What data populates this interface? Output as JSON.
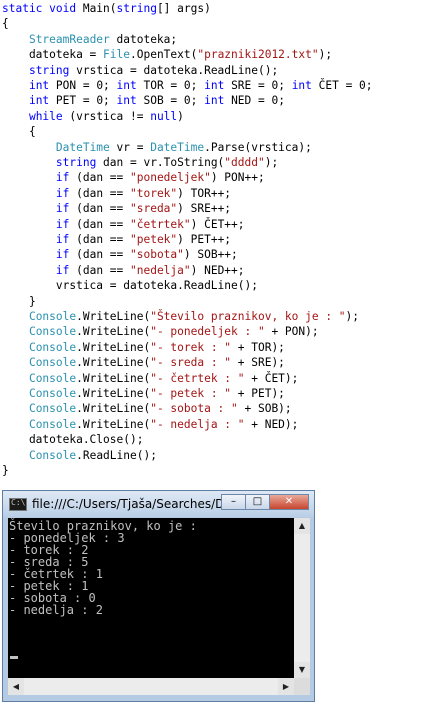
{
  "code": {
    "lines": [
      [
        {
          "t": "static void ",
          "c": "kw"
        },
        {
          "t": "Main(",
          "c": ""
        },
        {
          "t": "string",
          "c": "kw"
        },
        {
          "t": "[] args)",
          "c": ""
        }
      ],
      [
        {
          "t": "{",
          "c": ""
        }
      ],
      [
        {
          "t": "    ",
          "c": ""
        },
        {
          "t": "StreamReader",
          "c": "ty"
        },
        {
          "t": " datoteka;",
          "c": ""
        }
      ],
      [
        {
          "t": "    datoteka = ",
          "c": ""
        },
        {
          "t": "File",
          "c": "ty"
        },
        {
          "t": ".OpenText(",
          "c": ""
        },
        {
          "t": "\"prazniki2012.txt\"",
          "c": "st"
        },
        {
          "t": ");",
          "c": ""
        }
      ],
      [
        {
          "t": "    ",
          "c": ""
        },
        {
          "t": "string",
          "c": "kw"
        },
        {
          "t": " vrstica = datoteka.ReadLine();",
          "c": ""
        }
      ],
      [
        {
          "t": "    ",
          "c": ""
        },
        {
          "t": "int",
          "c": "kw"
        },
        {
          "t": " PON = 0; ",
          "c": ""
        },
        {
          "t": "int",
          "c": "kw"
        },
        {
          "t": " TOR = 0; ",
          "c": ""
        },
        {
          "t": "int",
          "c": "kw"
        },
        {
          "t": " SRE = 0; ",
          "c": ""
        },
        {
          "t": "int",
          "c": "kw"
        },
        {
          "t": " ČET = 0;",
          "c": ""
        }
      ],
      [
        {
          "t": "    ",
          "c": ""
        },
        {
          "t": "int",
          "c": "kw"
        },
        {
          "t": " PET = 0; ",
          "c": ""
        },
        {
          "t": "int",
          "c": "kw"
        },
        {
          "t": " SOB = 0; ",
          "c": ""
        },
        {
          "t": "int",
          "c": "kw"
        },
        {
          "t": " NED = 0;",
          "c": ""
        }
      ],
      [
        {
          "t": "    ",
          "c": ""
        },
        {
          "t": "while",
          "c": "kw"
        },
        {
          "t": " (vrstica != ",
          "c": ""
        },
        {
          "t": "null",
          "c": "kw"
        },
        {
          "t": ")",
          "c": ""
        }
      ],
      [
        {
          "t": "    {",
          "c": ""
        }
      ],
      [
        {
          "t": "        ",
          "c": ""
        },
        {
          "t": "DateTime",
          "c": "ty"
        },
        {
          "t": " vr = ",
          "c": ""
        },
        {
          "t": "DateTime",
          "c": "ty"
        },
        {
          "t": ".Parse(vrstica);",
          "c": ""
        }
      ],
      [
        {
          "t": "        ",
          "c": ""
        },
        {
          "t": "string",
          "c": "kw"
        },
        {
          "t": " dan = vr.ToString(",
          "c": ""
        },
        {
          "t": "\"dddd\"",
          "c": "st"
        },
        {
          "t": ");",
          "c": ""
        }
      ],
      [
        {
          "t": "        ",
          "c": ""
        },
        {
          "t": "if",
          "c": "kw"
        },
        {
          "t": " (dan == ",
          "c": ""
        },
        {
          "t": "\"ponedeljek\"",
          "c": "st"
        },
        {
          "t": ") PON++;",
          "c": ""
        }
      ],
      [
        {
          "t": "        ",
          "c": ""
        },
        {
          "t": "if",
          "c": "kw"
        },
        {
          "t": " (dan == ",
          "c": ""
        },
        {
          "t": "\"torek\"",
          "c": "st"
        },
        {
          "t": ") TOR++;",
          "c": ""
        }
      ],
      [
        {
          "t": "        ",
          "c": ""
        },
        {
          "t": "if",
          "c": "kw"
        },
        {
          "t": " (dan == ",
          "c": ""
        },
        {
          "t": "\"sreda\"",
          "c": "st"
        },
        {
          "t": ") SRE++;",
          "c": ""
        }
      ],
      [
        {
          "t": "        ",
          "c": ""
        },
        {
          "t": "if",
          "c": "kw"
        },
        {
          "t": " (dan == ",
          "c": ""
        },
        {
          "t": "\"četrtek\"",
          "c": "st"
        },
        {
          "t": ") ČET++;",
          "c": ""
        }
      ],
      [
        {
          "t": "        ",
          "c": ""
        },
        {
          "t": "if",
          "c": "kw"
        },
        {
          "t": " (dan == ",
          "c": ""
        },
        {
          "t": "\"petek\"",
          "c": "st"
        },
        {
          "t": ") PET++;",
          "c": ""
        }
      ],
      [
        {
          "t": "        ",
          "c": ""
        },
        {
          "t": "if",
          "c": "kw"
        },
        {
          "t": " (dan == ",
          "c": ""
        },
        {
          "t": "\"sobota\"",
          "c": "st"
        },
        {
          "t": ") SOB++;",
          "c": ""
        }
      ],
      [
        {
          "t": "        ",
          "c": ""
        },
        {
          "t": "if",
          "c": "kw"
        },
        {
          "t": " (dan == ",
          "c": ""
        },
        {
          "t": "\"nedelja\"",
          "c": "st"
        },
        {
          "t": ") NED++;",
          "c": ""
        }
      ],
      [
        {
          "t": "        vrstica = datoteka.ReadLine();",
          "c": ""
        }
      ],
      [
        {
          "t": "    }",
          "c": ""
        }
      ],
      [
        {
          "t": "    ",
          "c": ""
        },
        {
          "t": "Console",
          "c": "ty"
        },
        {
          "t": ".WriteLine(",
          "c": ""
        },
        {
          "t": "\"Število praznikov, ko je : \"",
          "c": "st"
        },
        {
          "t": ");",
          "c": ""
        }
      ],
      [
        {
          "t": "    ",
          "c": ""
        },
        {
          "t": "Console",
          "c": "ty"
        },
        {
          "t": ".WriteLine(",
          "c": ""
        },
        {
          "t": "\"- ponedeljek : \"",
          "c": "st"
        },
        {
          "t": " + PON);",
          "c": ""
        }
      ],
      [
        {
          "t": "    ",
          "c": ""
        },
        {
          "t": "Console",
          "c": "ty"
        },
        {
          "t": ".WriteLine(",
          "c": ""
        },
        {
          "t": "\"- torek : \"",
          "c": "st"
        },
        {
          "t": " + TOR);",
          "c": ""
        }
      ],
      [
        {
          "t": "    ",
          "c": ""
        },
        {
          "t": "Console",
          "c": "ty"
        },
        {
          "t": ".WriteLine(",
          "c": ""
        },
        {
          "t": "\"- sreda : \"",
          "c": "st"
        },
        {
          "t": " + SRE);",
          "c": ""
        }
      ],
      [
        {
          "t": "    ",
          "c": ""
        },
        {
          "t": "Console",
          "c": "ty"
        },
        {
          "t": ".WriteLine(",
          "c": ""
        },
        {
          "t": "\"- četrtek : \"",
          "c": "st"
        },
        {
          "t": " + ČET);",
          "c": ""
        }
      ],
      [
        {
          "t": "    ",
          "c": ""
        },
        {
          "t": "Console",
          "c": "ty"
        },
        {
          "t": ".WriteLine(",
          "c": ""
        },
        {
          "t": "\"- petek : \"",
          "c": "st"
        },
        {
          "t": " + PET);",
          "c": ""
        }
      ],
      [
        {
          "t": "    ",
          "c": ""
        },
        {
          "t": "Console",
          "c": "ty"
        },
        {
          "t": ".WriteLine(",
          "c": ""
        },
        {
          "t": "\"- sobota : \"",
          "c": "st"
        },
        {
          "t": " + SOB);",
          "c": ""
        }
      ],
      [
        {
          "t": "    ",
          "c": ""
        },
        {
          "t": "Console",
          "c": "ty"
        },
        {
          "t": ".WriteLine(",
          "c": ""
        },
        {
          "t": "\"- nedelja : \"",
          "c": "st"
        },
        {
          "t": " + NED);",
          "c": ""
        }
      ],
      [
        {
          "t": "    datoteka.Close();",
          "c": ""
        }
      ],
      [
        {
          "t": "    ",
          "c": ""
        },
        {
          "t": "Console",
          "c": "ty"
        },
        {
          "t": ".ReadLine();",
          "c": ""
        }
      ],
      [
        {
          "t": "}",
          "c": ""
        }
      ]
    ]
  },
  "console_window": {
    "title": "file:///C:/Users/Tjaša/Searches/D...",
    "icon_label": "C:\\",
    "minimize_label": "–",
    "maximize_label": "□",
    "close_label": "✕",
    "output_lines": [
      "Število praznikov, ko je :",
      "- ponedeljek : 3",
      "- torek : 2",
      "- sreda : 5",
      "- četrtek : 1",
      "- petek : 1",
      "- sobota : 0",
      "- nedelja : 2"
    ],
    "scroll_up": "▲",
    "scroll_down": "▼",
    "scroll_left": "◀",
    "scroll_right": "▶"
  }
}
